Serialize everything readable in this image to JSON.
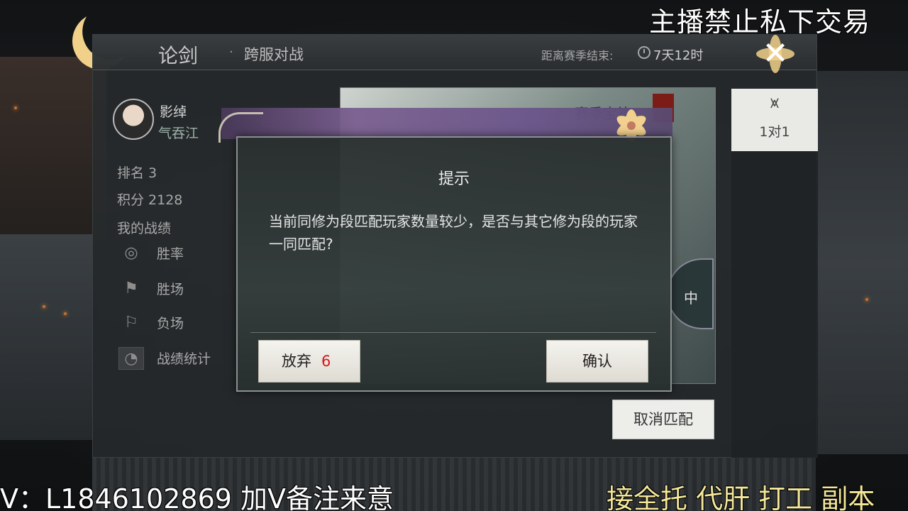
{
  "header": {
    "title": "论剑",
    "separator": "·",
    "subtitle": "跨服对战",
    "season_label": "距离赛季结束:",
    "season_remaining": "7天12时"
  },
  "player": {
    "name": "影绰",
    "guild": "气吞江",
    "rank_text": "排名 3",
    "score_text": "积分 2128",
    "records_title": "我的战绩"
  },
  "stats_menu": {
    "win_rate": "胜率",
    "wins": "胜场",
    "losses": "负场",
    "statistics": "战绩统计"
  },
  "mode_tab": {
    "icon": "mountain-icon",
    "label": "1对1"
  },
  "background_card": {
    "title": "赛季宝箱",
    "matching_text": "中"
  },
  "cancel_match_label": "取消匹配",
  "dialog": {
    "title": "提示",
    "message": "当前同修为段匹配玩家数量较少，是否与其它修为段的玩家一同匹配?",
    "abandon_label": "放弃",
    "abandon_countdown": "6",
    "confirm_label": "确认"
  },
  "stream_overlay": {
    "top_right": "主播禁止私下交易",
    "bottom_left": "V：L1846102869 加V备注来意",
    "bottom_right": "接全托 代肝 打工 副本"
  },
  "colors": {
    "countdown": "#d11a1a",
    "overlay_highlight": "#f4e79a",
    "dialog_band": "#7a5f90"
  }
}
